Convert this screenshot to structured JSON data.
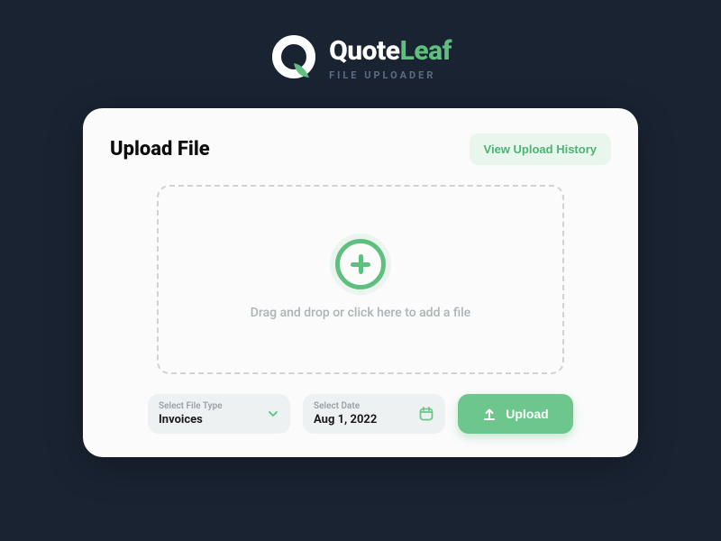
{
  "brand": {
    "name_a": "Quote",
    "name_b": "Leaf",
    "subtitle": "FILE UPLOADER"
  },
  "card": {
    "title": "Upload File",
    "history_label": "View Upload History",
    "dropzone_text": "Drag and drop or click here to add a file"
  },
  "controls": {
    "filetype": {
      "label": "Select File Type",
      "value": "Invoices"
    },
    "date": {
      "label": "Select Date",
      "value": "Aug 1, 2022"
    },
    "upload_label": "Upload"
  },
  "colors": {
    "bg": "#1a2332",
    "card": "#fbfbfb",
    "accent": "#5fbf7f",
    "accent_light": "#e8f6ed",
    "field_bg": "#eef1f2",
    "muted": "#aeb3b7"
  },
  "icons": {
    "logo": "quoteleaf-logo",
    "plus": "plus-circle-icon",
    "chevron": "chevron-down-icon",
    "calendar": "calendar-icon",
    "upload": "upload-icon"
  }
}
